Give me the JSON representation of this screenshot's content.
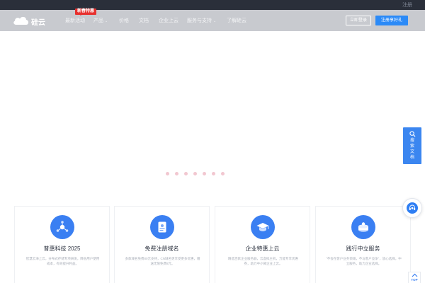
{
  "topbar": {
    "login": "注册"
  },
  "nav": {
    "logo_text": "硅云",
    "hot_badge": "新春特惠",
    "items": [
      {
        "label": "最新活动",
        "chevron": false
      },
      {
        "label": "产品",
        "chevron": true
      },
      {
        "label": "价格",
        "chevron": false
      },
      {
        "label": "文档",
        "chevron": false
      },
      {
        "label": "企业上云",
        "chevron": false
      },
      {
        "label": "服务与支持",
        "chevron": true
      },
      {
        "label": "了解硅云",
        "chevron": false
      }
    ],
    "console_button": "立即登录",
    "register_button": "注册享好礼"
  },
  "loading": {
    "dot_color": "#f2c7d0",
    "dot_count": 7
  },
  "cards": [
    {
      "icon": "network-icon",
      "title": "普惠科技 2025",
      "desc": "智慧云海上云，分布式存储专项研发，降低用户使用成本，有效提升利益。"
    },
    {
      "icon": "document-icon",
      "title": "免费注册域名",
      "desc": "多款域名免费80元支持，CN域名更享受更多优惠，赠送无限免费8元。"
    },
    {
      "icon": "graduation-cap-icon",
      "title": "企业特惠上云",
      "desc": "精选百款企业服务器，云虚拟主机，万能专享优惠券，助力中小微企业上云。"
    },
    {
      "icon": "stack-coins-icon",
      "title": "践行中立服务",
      "desc": "“不会在客户业务领域，不与客户竞争”，放心选择，中立服务，助力企业选择。"
    }
  ],
  "side": {
    "search_label": [
      "搜",
      "索",
      "文",
      "档"
    ],
    "top_label": "TOP"
  },
  "colors": {
    "accent": "#3a7ff2",
    "nav_bg": "#c8cacf",
    "topbar_bg": "#2a2f3a",
    "badge": "#e7312f"
  }
}
